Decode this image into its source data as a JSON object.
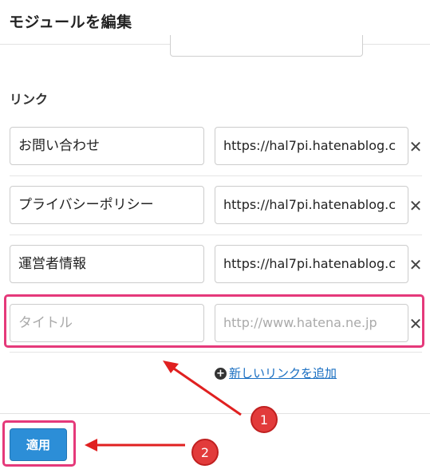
{
  "modal": {
    "title": "モジュールを編集"
  },
  "links_section": {
    "label": "リンク",
    "rows": [
      {
        "title": "お問い合わせ",
        "url": "https://hal7pi.hatenablog.c"
      },
      {
        "title": "プライバシーポリシー",
        "url": "https://hal7pi.hatenablog.c"
      },
      {
        "title": "運営者情報",
        "url": "https://hal7pi.hatenablog.c"
      }
    ],
    "new_row": {
      "title_placeholder": "タイトル",
      "url_placeholder": "http://www.hatena.ne.jp"
    },
    "delete_glyph": "✕",
    "add_link_label": "新しいリンクを追加",
    "add_icon_glyph": "+"
  },
  "footer": {
    "apply_label": "適用"
  },
  "annotations": [
    {
      "number": "1",
      "icon": "red-numbered-circle"
    },
    {
      "number": "2",
      "icon": "red-numbered-circle"
    }
  ],
  "colors": {
    "highlight": "#e5397a",
    "arrow": "#e02020",
    "apply_button": "#2c8ed7",
    "link": "#1a6fc2"
  }
}
